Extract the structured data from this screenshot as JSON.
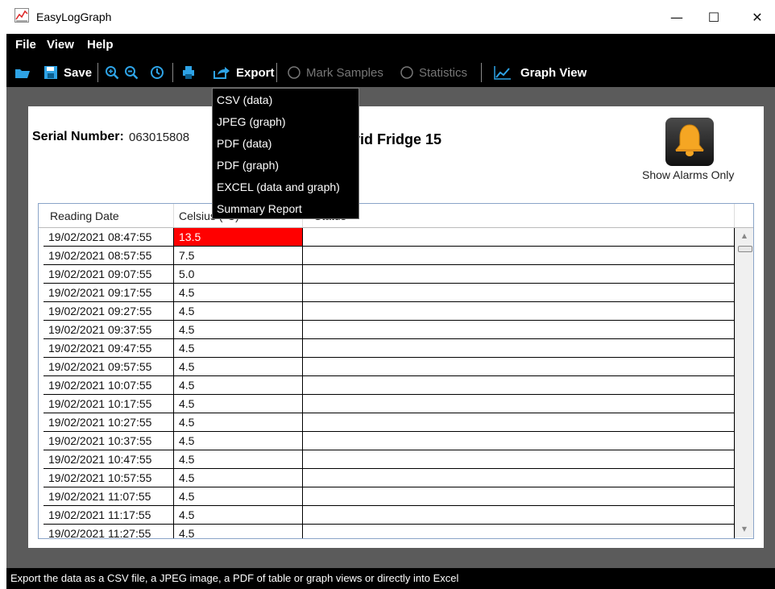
{
  "window": {
    "title": "EasyLogGraph",
    "minimize": "—",
    "maximize": "☐",
    "close": "✕"
  },
  "menu": {
    "file": "File",
    "view": "View",
    "help": "Help"
  },
  "toolbar": {
    "save": "Save",
    "export": "Export",
    "mark_samples": "Mark Samples",
    "statistics": "Statistics",
    "graph_view": "Graph View"
  },
  "export_menu": [
    "CSV (data)",
    "JPEG (graph)",
    "PDF (data)",
    "PDF (graph)",
    "EXCEL (data and graph)",
    "Summary Report"
  ],
  "header": {
    "serial_label": "Serial Number:",
    "serial_value": "063015808",
    "device_name_visible": "vid Fridge 15",
    "alarm_button_label": "Show Alarms Only"
  },
  "table": {
    "columns": [
      "Reading Date",
      "Celsius (°C)",
      "Status"
    ],
    "rows": [
      {
        "date": "19/02/2021 08:47:55",
        "celsius": "13.5",
        "alarm": true
      },
      {
        "date": "19/02/2021 08:57:55",
        "celsius": "7.5"
      },
      {
        "date": "19/02/2021 09:07:55",
        "celsius": "5.0"
      },
      {
        "date": "19/02/2021 09:17:55",
        "celsius": "4.5"
      },
      {
        "date": "19/02/2021 09:27:55",
        "celsius": "4.5"
      },
      {
        "date": "19/02/2021 09:37:55",
        "celsius": "4.5"
      },
      {
        "date": "19/02/2021 09:47:55",
        "celsius": "4.5"
      },
      {
        "date": "19/02/2021 09:57:55",
        "celsius": "4.5"
      },
      {
        "date": "19/02/2021 10:07:55",
        "celsius": "4.5"
      },
      {
        "date": "19/02/2021 10:17:55",
        "celsius": "4.5"
      },
      {
        "date": "19/02/2021 10:27:55",
        "celsius": "4.5"
      },
      {
        "date": "19/02/2021 10:37:55",
        "celsius": "4.5"
      },
      {
        "date": "19/02/2021 10:47:55",
        "celsius": "4.5"
      },
      {
        "date": "19/02/2021 10:57:55",
        "celsius": "4.5"
      },
      {
        "date": "19/02/2021 11:07:55",
        "celsius": "4.5"
      },
      {
        "date": "19/02/2021 11:17:55",
        "celsius": "4.5"
      },
      {
        "date": "19/02/2021 11:27:55",
        "celsius": "4.5"
      }
    ]
  },
  "status_bar": "Export the data as a CSV file, a JPEG image, a PDF of table or graph views or directly into Excel",
  "colors": {
    "alarm": "#ff0000",
    "toolbar": "#000000",
    "accent_icon": "#2ea3e6"
  }
}
